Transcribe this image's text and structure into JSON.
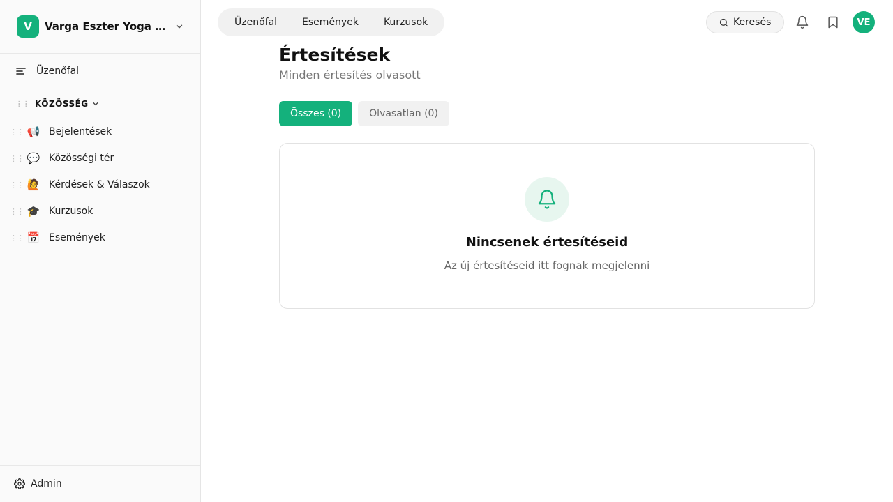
{
  "colors": {
    "accent": "#14b17c",
    "accent_soft": "#e7f6ef",
    "muted_text": "#777777"
  },
  "sidebar": {
    "brand": {
      "logo_letter": "V",
      "name": "Varga Eszter Yoga & Wellness",
      "chevron_icon": "chevron-down-icon"
    },
    "feed": {
      "icon": "list-lines-icon",
      "label": "Üzenőfal"
    },
    "section": {
      "label": "KÖZÖSSÉG",
      "chevron_icon": "chevron-down-icon"
    },
    "spaces": [
      {
        "emoji": "📢",
        "label": "Bejelentések"
      },
      {
        "emoji": "💬",
        "label": "Közösségi tér"
      },
      {
        "emoji": "🙋",
        "label": "Kérdések & Válaszok"
      },
      {
        "emoji": "🎓",
        "label": "Kurzusok"
      },
      {
        "emoji": "📅",
        "label": "Események"
      }
    ],
    "footer": {
      "icon": "gear-icon",
      "label": "Admin"
    }
  },
  "topbar": {
    "tabs": [
      {
        "label": "Üzenőfal"
      },
      {
        "label": "Események"
      },
      {
        "label": "Kurzusok"
      }
    ],
    "search": {
      "icon": "search-icon",
      "label": "Keresés"
    },
    "icons": [
      "bell-icon",
      "bookmark-icon"
    ],
    "avatar": {
      "initials": "VE"
    }
  },
  "main": {
    "title": "Értesítések",
    "subtitle": "Minden értesítés olvasott",
    "filters": [
      {
        "label": "Összes (0)",
        "active": true
      },
      {
        "label": "Olvasatlan (0)",
        "active": false
      }
    ],
    "empty": {
      "icon": "bell-icon",
      "title": "Nincsenek értesítéseid",
      "text": "Az új értesítéseid itt fognak megjelenni"
    }
  }
}
